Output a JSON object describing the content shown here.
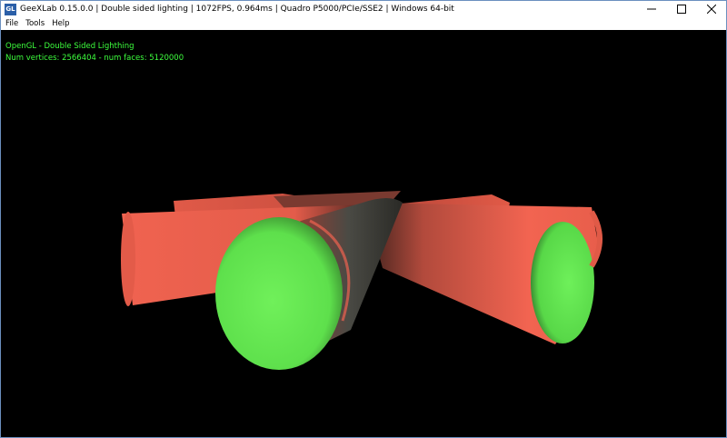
{
  "window": {
    "title": "GeeXLab 0.15.0.0 | Double sided lighting | 1072FPS, 0.964ms | Quadro P5000/PCIe/SSE2 | Windows 64-bit",
    "app_icon_text": "GL"
  },
  "menu": {
    "items": [
      "File",
      "Tools",
      "Help"
    ]
  },
  "overlay": {
    "line1": "OpenGL - Double Sided Lighthing",
    "line2": "Num vertices: 2566404 - num faces: 5120000"
  },
  "colors": {
    "overlay_text": "#3dff3d",
    "cylinder_outside": "#f2634f",
    "cylinder_inside": "#66ee55",
    "background": "#000000"
  }
}
